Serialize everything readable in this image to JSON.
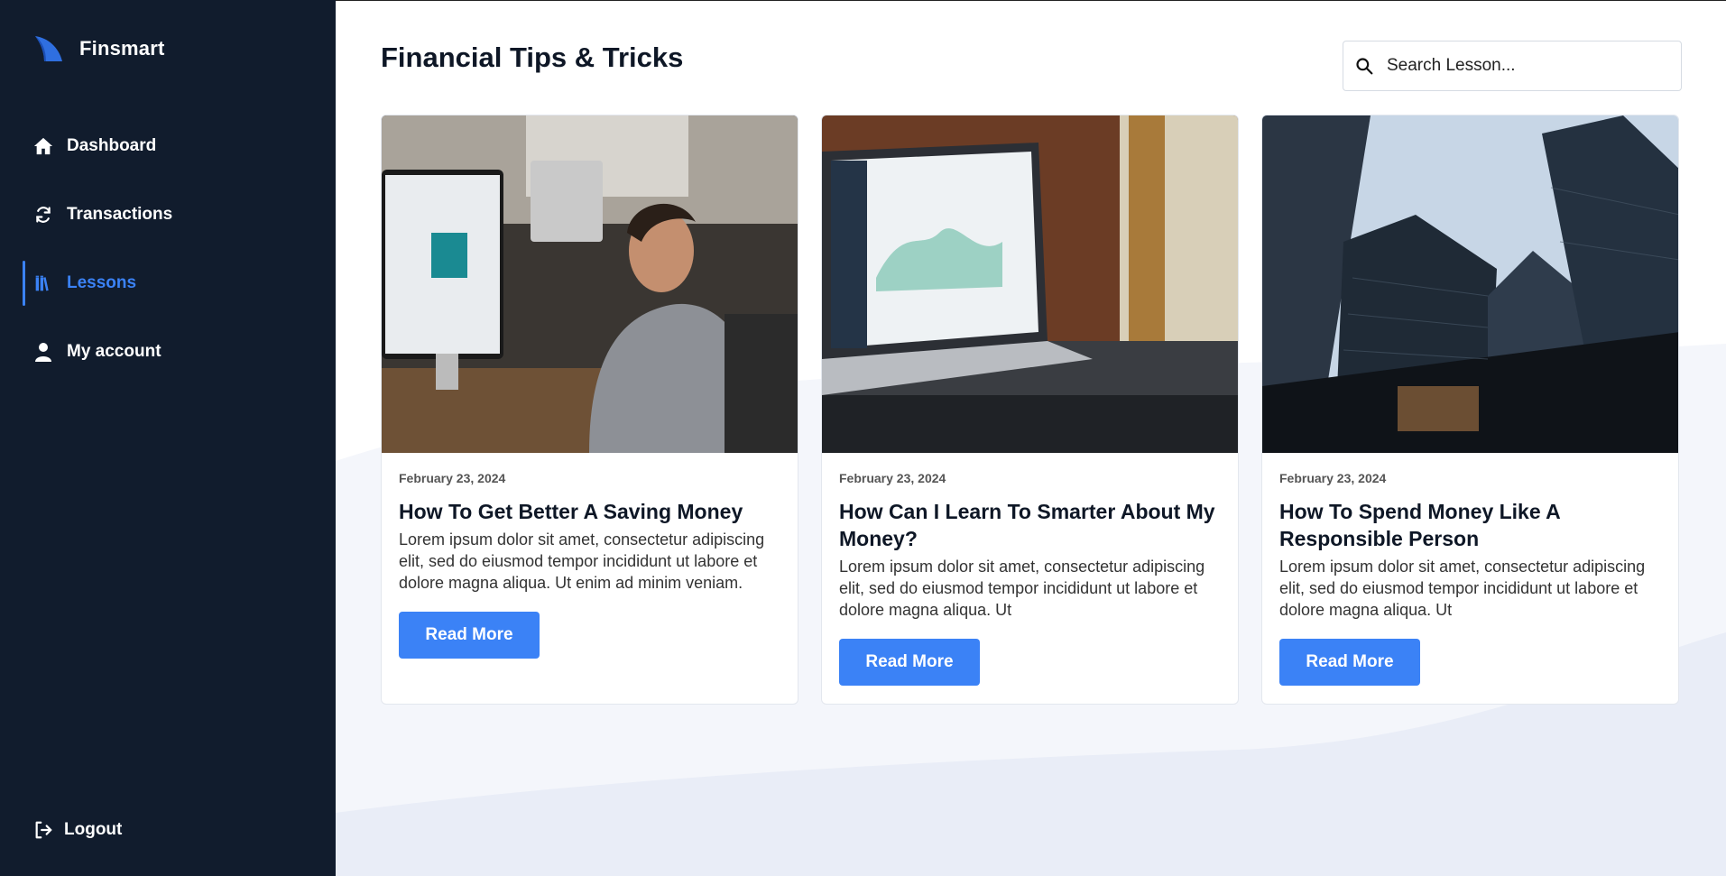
{
  "brand": {
    "name": "Finsmart",
    "logo_icon": "shark-fin-logo"
  },
  "sidebar": {
    "items": [
      {
        "label": "Dashboard",
        "icon": "home-icon",
        "active": false
      },
      {
        "label": "Transactions",
        "icon": "refresh-icon",
        "active": false
      },
      {
        "label": "Lessons",
        "icon": "books-icon",
        "active": true
      },
      {
        "label": "My account",
        "icon": "user-icon",
        "active": false
      }
    ],
    "logout": {
      "label": "Logout",
      "icon": "logout-icon"
    }
  },
  "header": {
    "title": "Financial Tips & Tricks",
    "search": {
      "placeholder": "Search Lesson...",
      "value": "",
      "icon": "search-icon"
    }
  },
  "cards": [
    {
      "image": "office-worker-photo",
      "date": "February 23, 2024",
      "title": "How To Get Better A Saving Money",
      "text": "Lorem ipsum dolor sit amet, consectetur adipiscing elit, sed do eiusmod tempor incididunt ut labore et dolore magna aliqua. Ut enim ad minim veniam.",
      "button": "Read More"
    },
    {
      "image": "laptop-dashboard-photo",
      "date": "February 23, 2024",
      "title": "How Can I Learn To Smarter About My Money?",
      "text": "Lorem ipsum dolor sit amet, consectetur adipiscing elit, sed do eiusmod tempor incididunt ut labore et dolore magna aliqua. Ut",
      "button": "Read More"
    },
    {
      "image": "skyscrapers-photo",
      "date": "February 23, 2024",
      "title": "How To Spend Money Like A Responsible Person",
      "text": "Lorem ipsum dolor sit amet, consectetur adipiscing elit, sed do eiusmod tempor incididunt ut labore et dolore magna aliqua. Ut",
      "button": "Read More"
    }
  ],
  "colors": {
    "sidebar_bg": "#111c2d",
    "accent": "#3b82f6",
    "text_dark": "#0e1726"
  }
}
